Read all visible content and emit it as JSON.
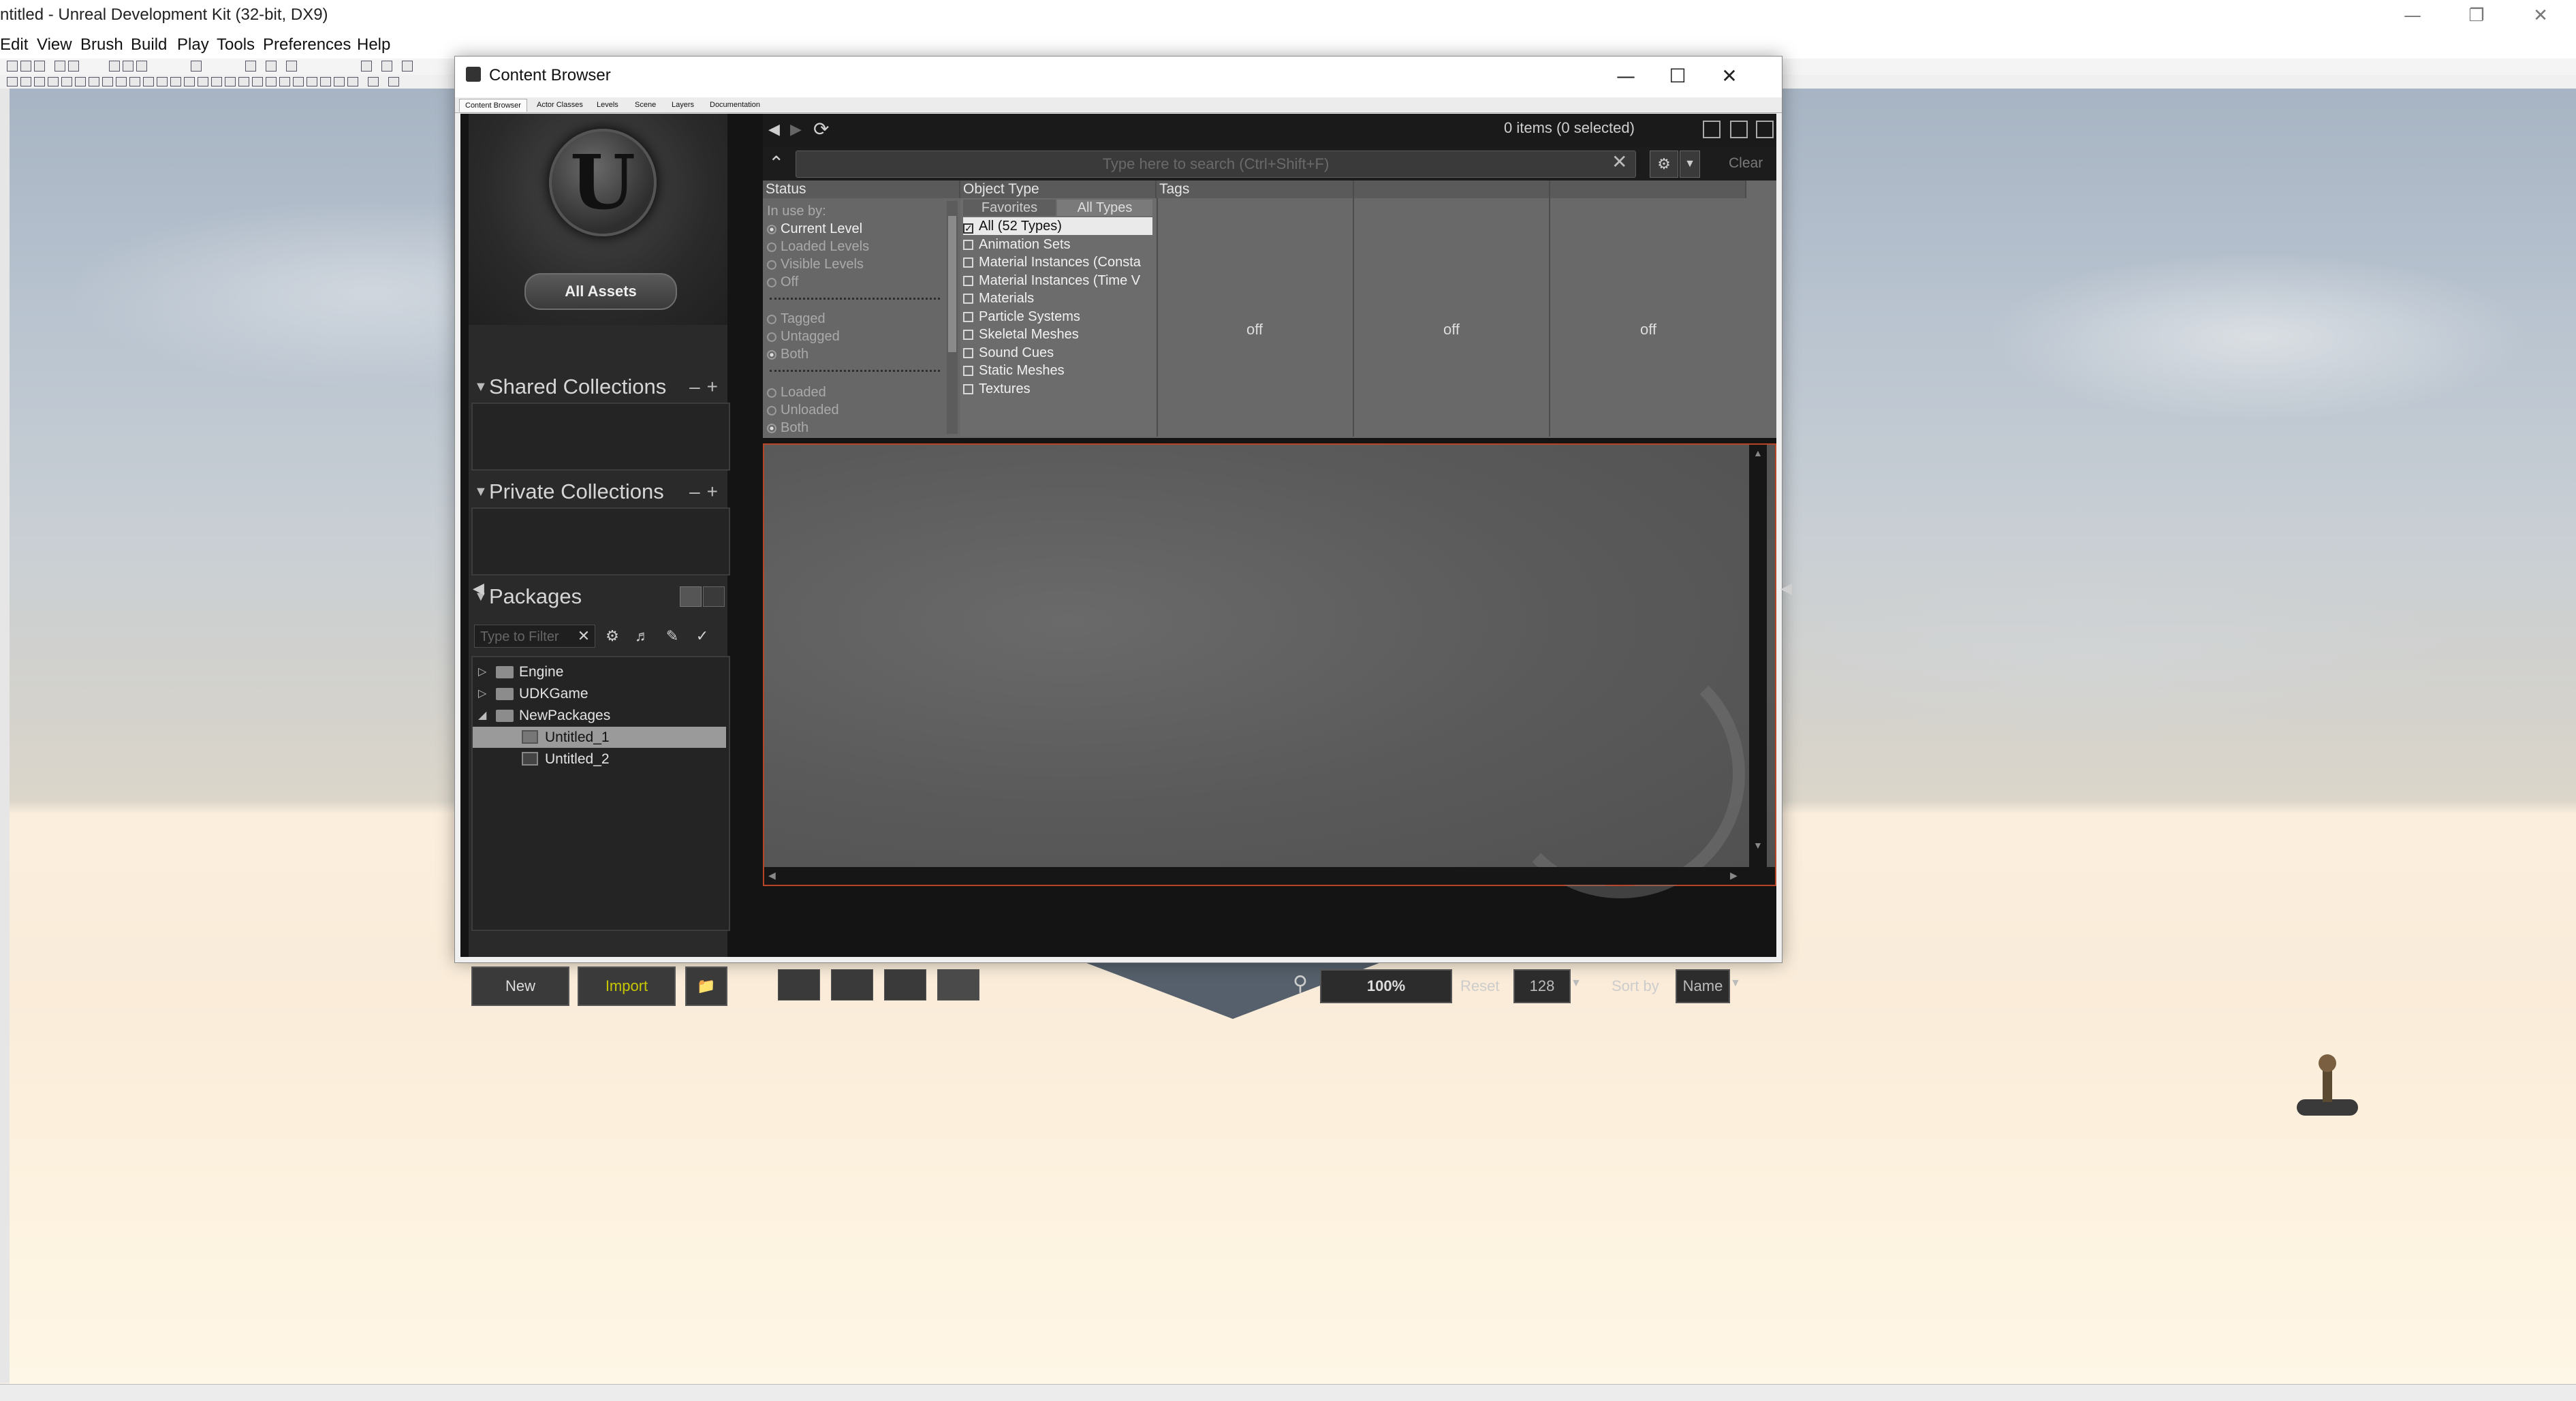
{
  "app": {
    "title": "ntitled - Unreal Development Kit (32-bit, DX9)",
    "menu": [
      "Edit",
      "View",
      "Brush",
      "Build",
      "Play",
      "Tools",
      "Preferences",
      "Help"
    ]
  },
  "content_browser": {
    "title": "Content Browser",
    "tabs": [
      "Content Browser",
      "Actor Classes",
      "Levels",
      "Scene",
      "Layers",
      "Documentation"
    ],
    "items_count": "0 items (0 selected)",
    "search_placeholder": "Type here to search  (Ctrl+Shift+F)",
    "clear_label": "Clear",
    "all_assets_label": "All Assets",
    "shared_collections_label": "Shared Collections",
    "private_collections_label": "Private Collections",
    "packages_label": "Packages",
    "filter_placeholder": "Type to Filter",
    "status": {
      "header": "Status",
      "in_use_by_label": "In use by:",
      "group1": [
        {
          "label": "Current Level",
          "selected": true
        },
        {
          "label": "Loaded Levels",
          "selected": false
        },
        {
          "label": "Visible Levels",
          "selected": false
        },
        {
          "label": "Off",
          "selected": false
        }
      ],
      "group2": [
        {
          "label": "Tagged",
          "selected": false
        },
        {
          "label": "Untagged",
          "selected": false
        },
        {
          "label": "Both",
          "selected": true
        }
      ],
      "group3": [
        {
          "label": "Loaded",
          "selected": false
        },
        {
          "label": "Unloaded",
          "selected": false
        },
        {
          "label": "Both",
          "selected": true
        }
      ]
    },
    "object_type": {
      "header": "Object Type",
      "tab_favorites": "Favorites",
      "tab_all_types": "All Types",
      "items": [
        {
          "label": "All (52 Types)",
          "checked": true
        },
        {
          "label": "Animation Sets",
          "checked": false
        },
        {
          "label": "Material Instances (Consta",
          "checked": false
        },
        {
          "label": "Material Instances (Time V",
          "checked": false
        },
        {
          "label": "Materials",
          "checked": false
        },
        {
          "label": "Particle Systems",
          "checked": false
        },
        {
          "label": "Skeletal Meshes",
          "checked": false
        },
        {
          "label": "Sound Cues",
          "checked": false
        },
        {
          "label": "Static Meshes",
          "checked": false
        },
        {
          "label": "Textures",
          "checked": false
        }
      ]
    },
    "tags": {
      "header": "Tags",
      "col1_value": "off",
      "col2_value": "off",
      "col3_value": "off"
    },
    "packages": [
      {
        "label": "Engine",
        "type": "folder",
        "expanded": false
      },
      {
        "label": "UDKGame",
        "type": "folder",
        "expanded": false
      },
      {
        "label": "NewPackages",
        "type": "folder",
        "expanded": true
      },
      {
        "label": "Untitled_1",
        "type": "package",
        "selected": true
      },
      {
        "label": "Untitled_2",
        "type": "package",
        "selected": false
      }
    ],
    "buttons": {
      "new": "New",
      "import": "Import"
    },
    "zoom": "100%",
    "reset_label": "Reset",
    "thumb_size": "128",
    "sort_by_label": "Sort by",
    "sort_value": "Name"
  },
  "icons": {
    "minimize": "minimize-icon",
    "maximize": "maximize-icon",
    "close": "close-icon"
  },
  "colors": {
    "asset_view_border": "#b84428",
    "import_text": "#c8c800"
  }
}
